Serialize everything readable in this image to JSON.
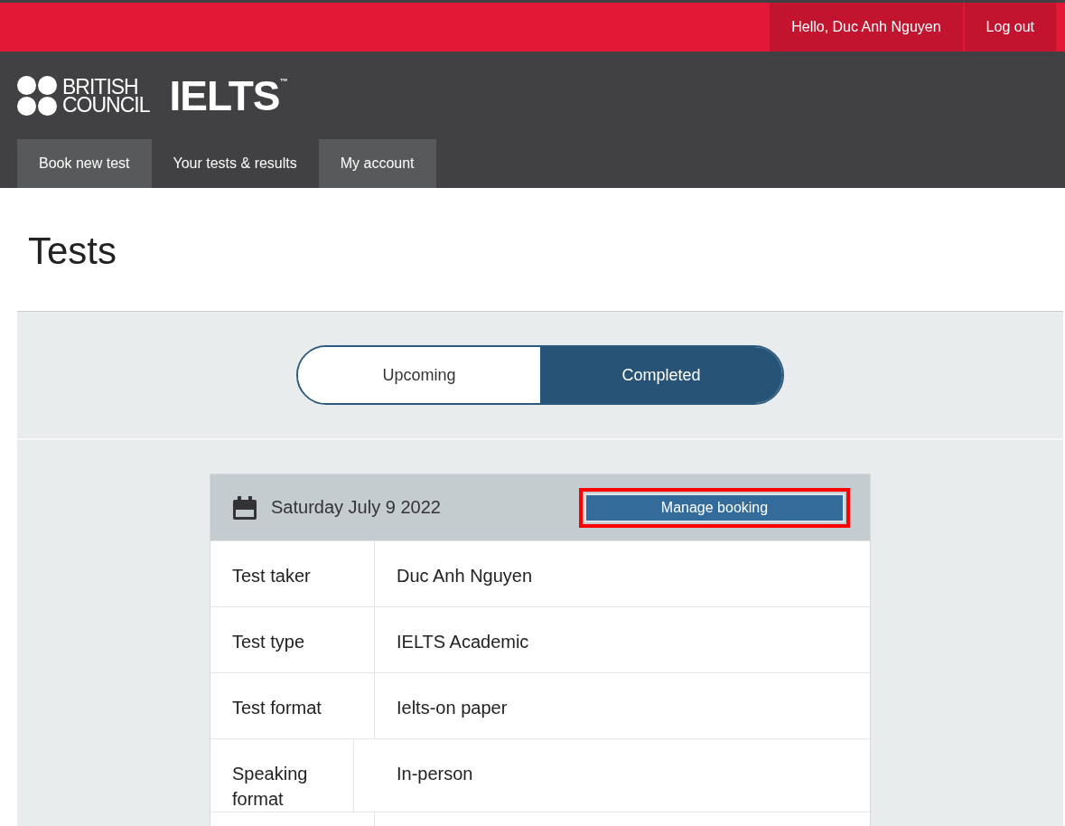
{
  "top_bar": {
    "greeting": "Hello, Duc Anh Nguyen",
    "logout": "Log out"
  },
  "logo": {
    "brand_line_1": "BRITISH",
    "brand_line_2": "COUNCIL",
    "product": "IELTS",
    "trademark": "™"
  },
  "nav_tabs": [
    {
      "label": "Book new test",
      "selected": false
    },
    {
      "label": "Your tests & results",
      "selected": true
    },
    {
      "label": "My account",
      "selected": false
    }
  ],
  "page_title": "Tests",
  "toggle": [
    {
      "label": "Upcoming",
      "selected": false
    },
    {
      "label": "Completed",
      "selected": true
    }
  ],
  "booking": {
    "date": "Saturday July 9 2022",
    "manage_button": "Manage booking",
    "highlighted": true,
    "rows": [
      {
        "label": "Test taker",
        "value": "Duc Anh Nguyen"
      },
      {
        "label": "Test type",
        "value": "IELTS Academic"
      },
      {
        "label": "Test format",
        "value": "Ielts-on paper"
      },
      {
        "label": "Speaking format",
        "value": "In-person"
      }
    ]
  }
}
